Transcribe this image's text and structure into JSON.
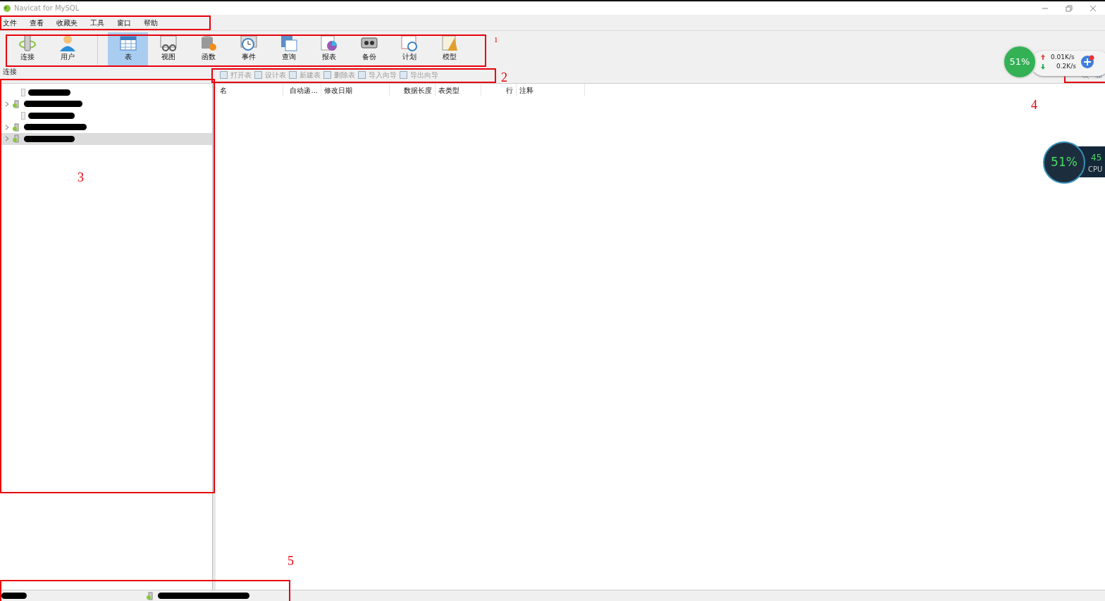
{
  "window": {
    "title": "Navicat for MySQL"
  },
  "menu": [
    "文件",
    "查看",
    "收藏夹",
    "工具",
    "窗口",
    "帮助"
  ],
  "toolbar": [
    {
      "label": "连接",
      "kind": "connection",
      "selected": false
    },
    {
      "label": "用户",
      "kind": "user",
      "selected": false
    },
    {
      "label": "表",
      "kind": "table",
      "selected": true
    },
    {
      "label": "视图",
      "kind": "view",
      "selected": false
    },
    {
      "label": "函数",
      "kind": "function",
      "selected": false
    },
    {
      "label": "事件",
      "kind": "event",
      "selected": false
    },
    {
      "label": "查询",
      "kind": "query",
      "selected": false
    },
    {
      "label": "报表",
      "kind": "report",
      "selected": false
    },
    {
      "label": "备份",
      "kind": "backup",
      "selected": false
    },
    {
      "label": "计划",
      "kind": "schedule",
      "selected": false
    },
    {
      "label": "模型",
      "kind": "model",
      "selected": false
    }
  ],
  "left_panel": {
    "title": "连接",
    "items": [
      {
        "expandable": false,
        "selected": false
      },
      {
        "expandable": true,
        "selected": false
      },
      {
        "expandable": false,
        "selected": false
      },
      {
        "expandable": true,
        "selected": false
      },
      {
        "expandable": true,
        "selected": true
      }
    ]
  },
  "object_toolbar": [
    {
      "label": "打开表",
      "disabled": true
    },
    {
      "label": "设计表",
      "disabled": true
    },
    {
      "label": "新建表",
      "disabled": true
    },
    {
      "label": "删除表",
      "disabled": true
    },
    {
      "label": "导入向导",
      "disabled": true
    },
    {
      "label": "导出向导",
      "disabled": true
    }
  ],
  "table": {
    "columns": [
      {
        "label": "名"
      },
      {
        "label": "自动递..."
      },
      {
        "label": "修改日期"
      },
      {
        "label": "数据长度"
      },
      {
        "label": "表类型"
      },
      {
        "label": "行"
      },
      {
        "label": "注释"
      }
    ]
  },
  "network_widget": {
    "percent": "51%",
    "upload": "0.01K/s",
    "download": "0.2K/s"
  },
  "cpu_widget": {
    "percent": "51%",
    "temperature": "45",
    "label": "CPU"
  },
  "annotations": [
    {
      "label": "1"
    },
    {
      "label": "2"
    },
    {
      "label": "3"
    },
    {
      "label": "4"
    },
    {
      "label": "5"
    }
  ]
}
